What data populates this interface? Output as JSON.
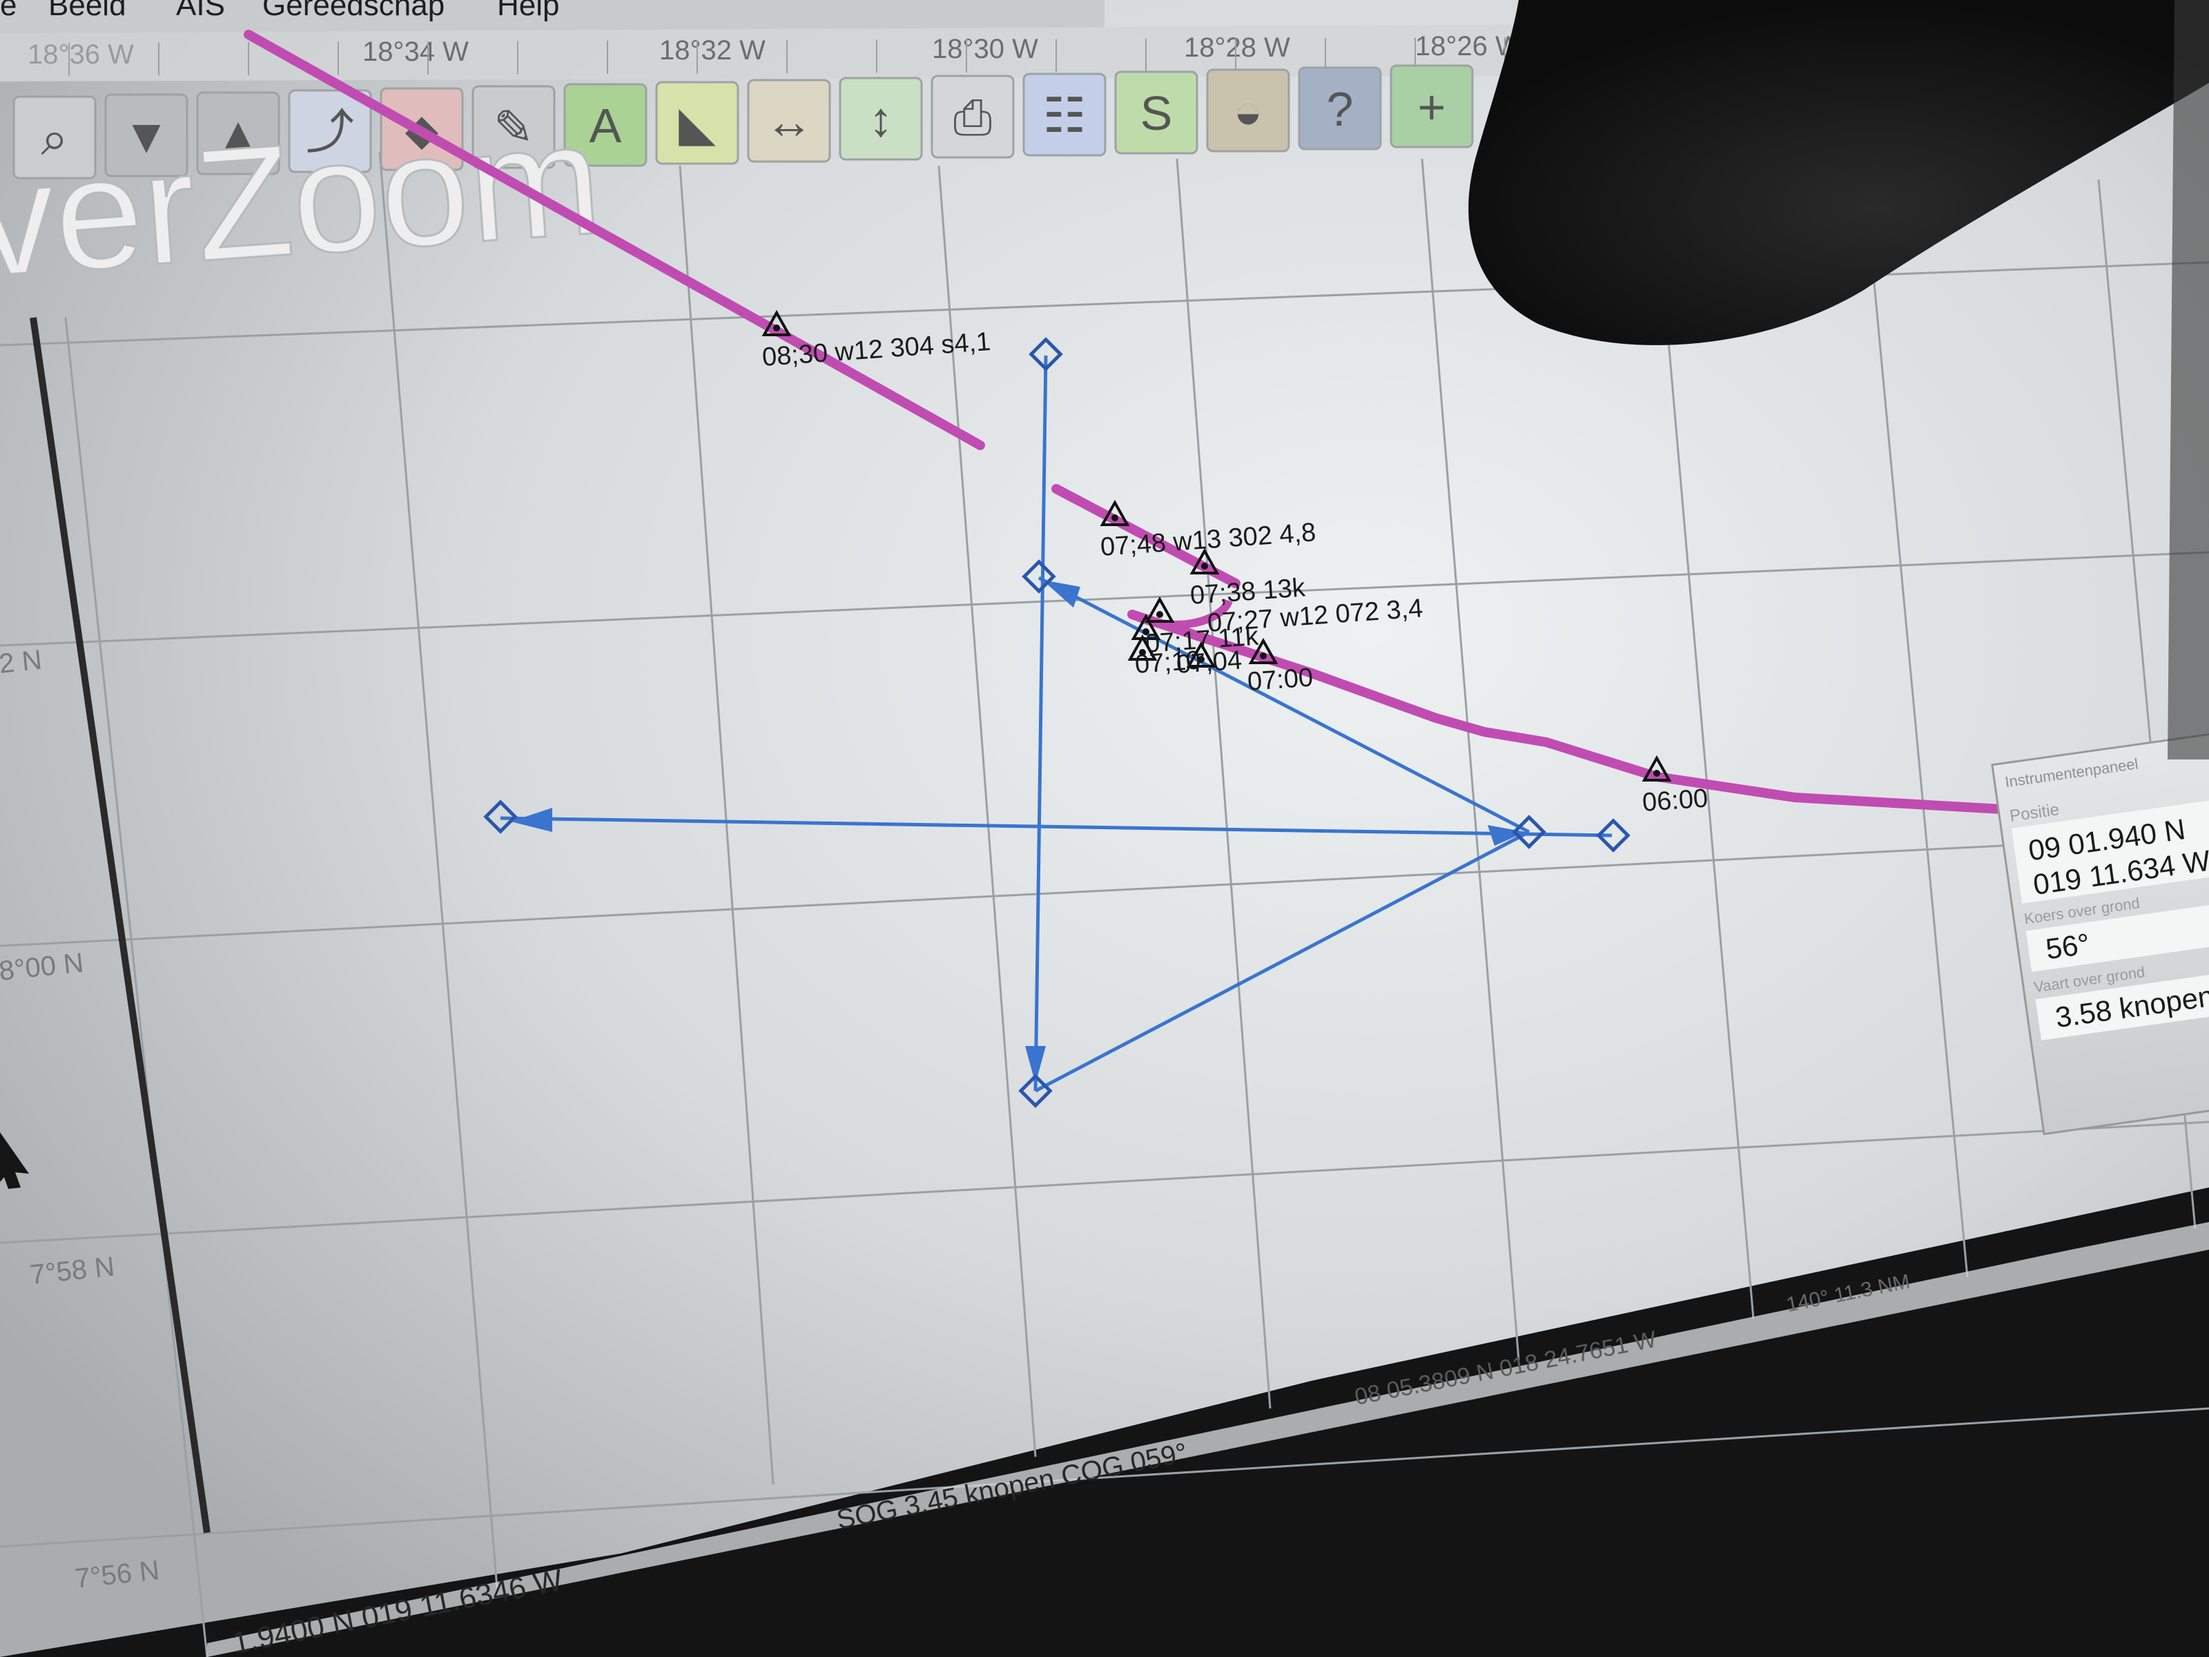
{
  "menu": {
    "items": [
      {
        "label": "e"
      },
      {
        "label": "Beeld"
      },
      {
        "label": "AIS"
      },
      {
        "label": "Gereedschap"
      },
      {
        "label": "Help"
      }
    ]
  },
  "scale": {
    "longitude_labels": [
      "18°36 W",
      "18°34 W",
      "18°32 W",
      "18°30 W",
      "18°28 W",
      "18°26 W"
    ],
    "latitude_labels": [
      "2 N",
      "8°00 N",
      "7°58 N",
      "7°56 N"
    ]
  },
  "toolbar": {
    "tools": [
      {
        "icon": "zoom-icon"
      },
      {
        "icon": "funnel-icon"
      },
      {
        "icon": "mark-icon"
      },
      {
        "icon": "route-icon"
      },
      {
        "icon": "boat-icon"
      },
      {
        "icon": "wrench-icon"
      },
      {
        "icon": "text-add-icon"
      },
      {
        "icon": "waypoint-add-icon"
      },
      {
        "icon": "measure-horizontal-icon"
      },
      {
        "icon": "measure-vertical-icon"
      },
      {
        "icon": "print-icon"
      },
      {
        "icon": "route-list-icon"
      },
      {
        "icon": "track-icon"
      },
      {
        "icon": "tide-icon"
      },
      {
        "icon": "help-icon"
      },
      {
        "icon": "extra-icon"
      }
    ],
    "right_icons": [
      {
        "icon": "compass-icon"
      },
      {
        "icon": "signal-icon"
      }
    ]
  },
  "watermark": {
    "text": "verZoom"
  },
  "track_marks": [
    {
      "label": "08;30 w12 304 s4,1"
    },
    {
      "label": "07;48 w13 302 4,8"
    },
    {
      "label": "07;38 13k"
    },
    {
      "label": "07;27 w12 072 3,4"
    },
    {
      "label": "07;17 11k"
    },
    {
      "label": "07;10"
    },
    {
      "label": "07;04"
    },
    {
      "label": "07:00"
    },
    {
      "label": "06:00"
    }
  ],
  "instrument_panel": {
    "title": "Instrumentenpaneel",
    "position_label": "Positie",
    "latitude": "09 01.940 N",
    "longitude": "019 11.634 W",
    "cog_label": "Koers over grond",
    "cog": "56°",
    "sog_label": "Vaart over grond",
    "sog": "3.58 knopen"
  },
  "status_bar": {
    "position": "1.9400 N   019 11.6346 W",
    "sog_cog": "SOG 3.45 knopen   COG 059°",
    "cursor": "08 05.3809 N   018 24.7651 W",
    "extra": "140° 11.3 NM"
  },
  "colors": {
    "chart_bg": "#d8dcde",
    "grid": "#9aa0a4",
    "track": "#c04cb2",
    "route": "#3a74cf",
    "text": "#1a1a1a"
  }
}
